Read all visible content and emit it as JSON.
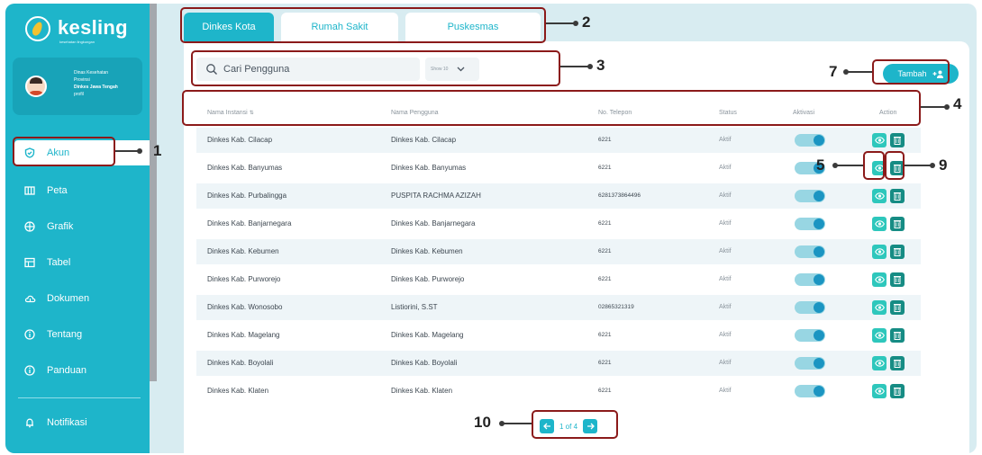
{
  "app": {
    "logo_text": "kesling",
    "logo_subtitle": "kesehatan lingkungan"
  },
  "profile": {
    "lines": [
      "Dinas Kesehatan",
      "Provinsi",
      "Dinkes Jawa Tengah",
      "profil"
    ]
  },
  "sidebar": {
    "items": [
      {
        "label": "Akun",
        "icon": "shield-check-icon"
      },
      {
        "label": "Peta",
        "icon": "map-icon"
      },
      {
        "label": "Grafik",
        "icon": "chart-icon"
      },
      {
        "label": "Tabel",
        "icon": "table-icon"
      },
      {
        "label": "Dokumen",
        "icon": "cloud-icon"
      },
      {
        "label": "Tentang",
        "icon": "info-icon"
      },
      {
        "label": "Panduan",
        "icon": "info-icon"
      },
      {
        "label": "Notifikasi",
        "icon": "bell-icon"
      }
    ]
  },
  "tabs": [
    {
      "label": "Dinkes Kota"
    },
    {
      "label": "Rumah Sakit"
    },
    {
      "label": "Puskesmas"
    }
  ],
  "search": {
    "placeholder": "Cari Pengguna",
    "show_label": "Show 10"
  },
  "tambah": {
    "label": "Tambah"
  },
  "table": {
    "headers": [
      "Nama Instansi",
      "Nama Pengguna",
      "No. Telepon",
      "Status",
      "Aktivasi",
      "Action"
    ],
    "rows": [
      {
        "instansi": "Dinkes Kab. Cilacap",
        "pengguna": "Dinkes Kab. Cilacap",
        "telepon": "6221",
        "status": "Aktif",
        "aktivasi": true
      },
      {
        "instansi": "Dinkes Kab. Banyumas",
        "pengguna": "Dinkes Kab. Banyumas",
        "telepon": "6221",
        "status": "Aktif",
        "aktivasi": true
      },
      {
        "instansi": "Dinkes Kab. Purbalingga",
        "pengguna": "PUSPITA RACHMA AZIZAH",
        "telepon": "6281373864496",
        "status": "Aktif",
        "aktivasi": true
      },
      {
        "instansi": "Dinkes Kab. Banjarnegara",
        "pengguna": "Dinkes Kab. Banjarnegara",
        "telepon": "6221",
        "status": "Aktif",
        "aktivasi": true
      },
      {
        "instansi": "Dinkes Kab. Kebumen",
        "pengguna": "Dinkes Kab. Kebumen",
        "telepon": "6221",
        "status": "Aktif",
        "aktivasi": true
      },
      {
        "instansi": "Dinkes Kab. Purworejo",
        "pengguna": "Dinkes Kab. Purworejo",
        "telepon": "6221",
        "status": "Aktif",
        "aktivasi": true
      },
      {
        "instansi": "Dinkes Kab. Wonosobo",
        "pengguna": "Listiorini, S.ST",
        "telepon": "02865321319",
        "status": "Aktif",
        "aktivasi": true
      },
      {
        "instansi": "Dinkes Kab. Magelang",
        "pengguna": "Dinkes Kab. Magelang",
        "telepon": "6221",
        "status": "Aktif",
        "aktivasi": true
      },
      {
        "instansi": "Dinkes Kab. Boyolali",
        "pengguna": "Dinkes Kab. Boyolali",
        "telepon": "6221",
        "status": "Aktif",
        "aktivasi": true
      },
      {
        "instansi": "Dinkes Kab. Klaten",
        "pengguna": "Dinkes Kab. Klaten",
        "telepon": "6221",
        "status": "Aktif",
        "aktivasi": true
      }
    ]
  },
  "pagination": {
    "text": "1 of 4"
  },
  "annotations": [
    "1",
    "2",
    "3",
    "4",
    "5",
    "7",
    "9",
    "10"
  ],
  "colors": {
    "accent": "#1eb5ca",
    "annotation_box": "#8b1a1a",
    "toggle_knob": "#1b95c2",
    "view_btn": "#2ec7bc",
    "delete_btn": "#168c84"
  }
}
